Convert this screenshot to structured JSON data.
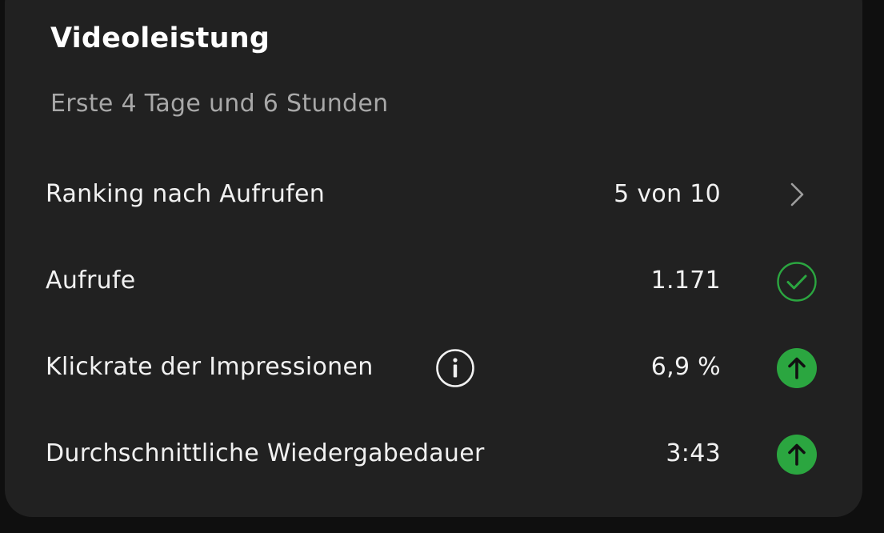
{
  "card": {
    "title": "Videoleistung",
    "subtitle": "Erste 4 Tage und 6 Stunden"
  },
  "rows": [
    {
      "label": "Ranking nach Aufrufen",
      "value": "5 von 10",
      "icon": "chevron-right-icon"
    },
    {
      "label": "Aufrufe",
      "value": "1.171",
      "icon": "check-circle-icon"
    },
    {
      "label": "Klickrate der Impressionen",
      "value": "6,9 %",
      "icon": "arrow-up-circle-icon",
      "info_icon": "info-icon"
    },
    {
      "label": "Durchschnittliche Wiedergabedauer",
      "value": "3:43",
      "icon": "arrow-up-circle-icon"
    }
  ],
  "colors": {
    "card_background": "#212121",
    "page_background": "#0f0f0f",
    "positive_green": "#2ba640",
    "text_primary": "#f1f1f1",
    "text_secondary": "#a8a8a8"
  }
}
